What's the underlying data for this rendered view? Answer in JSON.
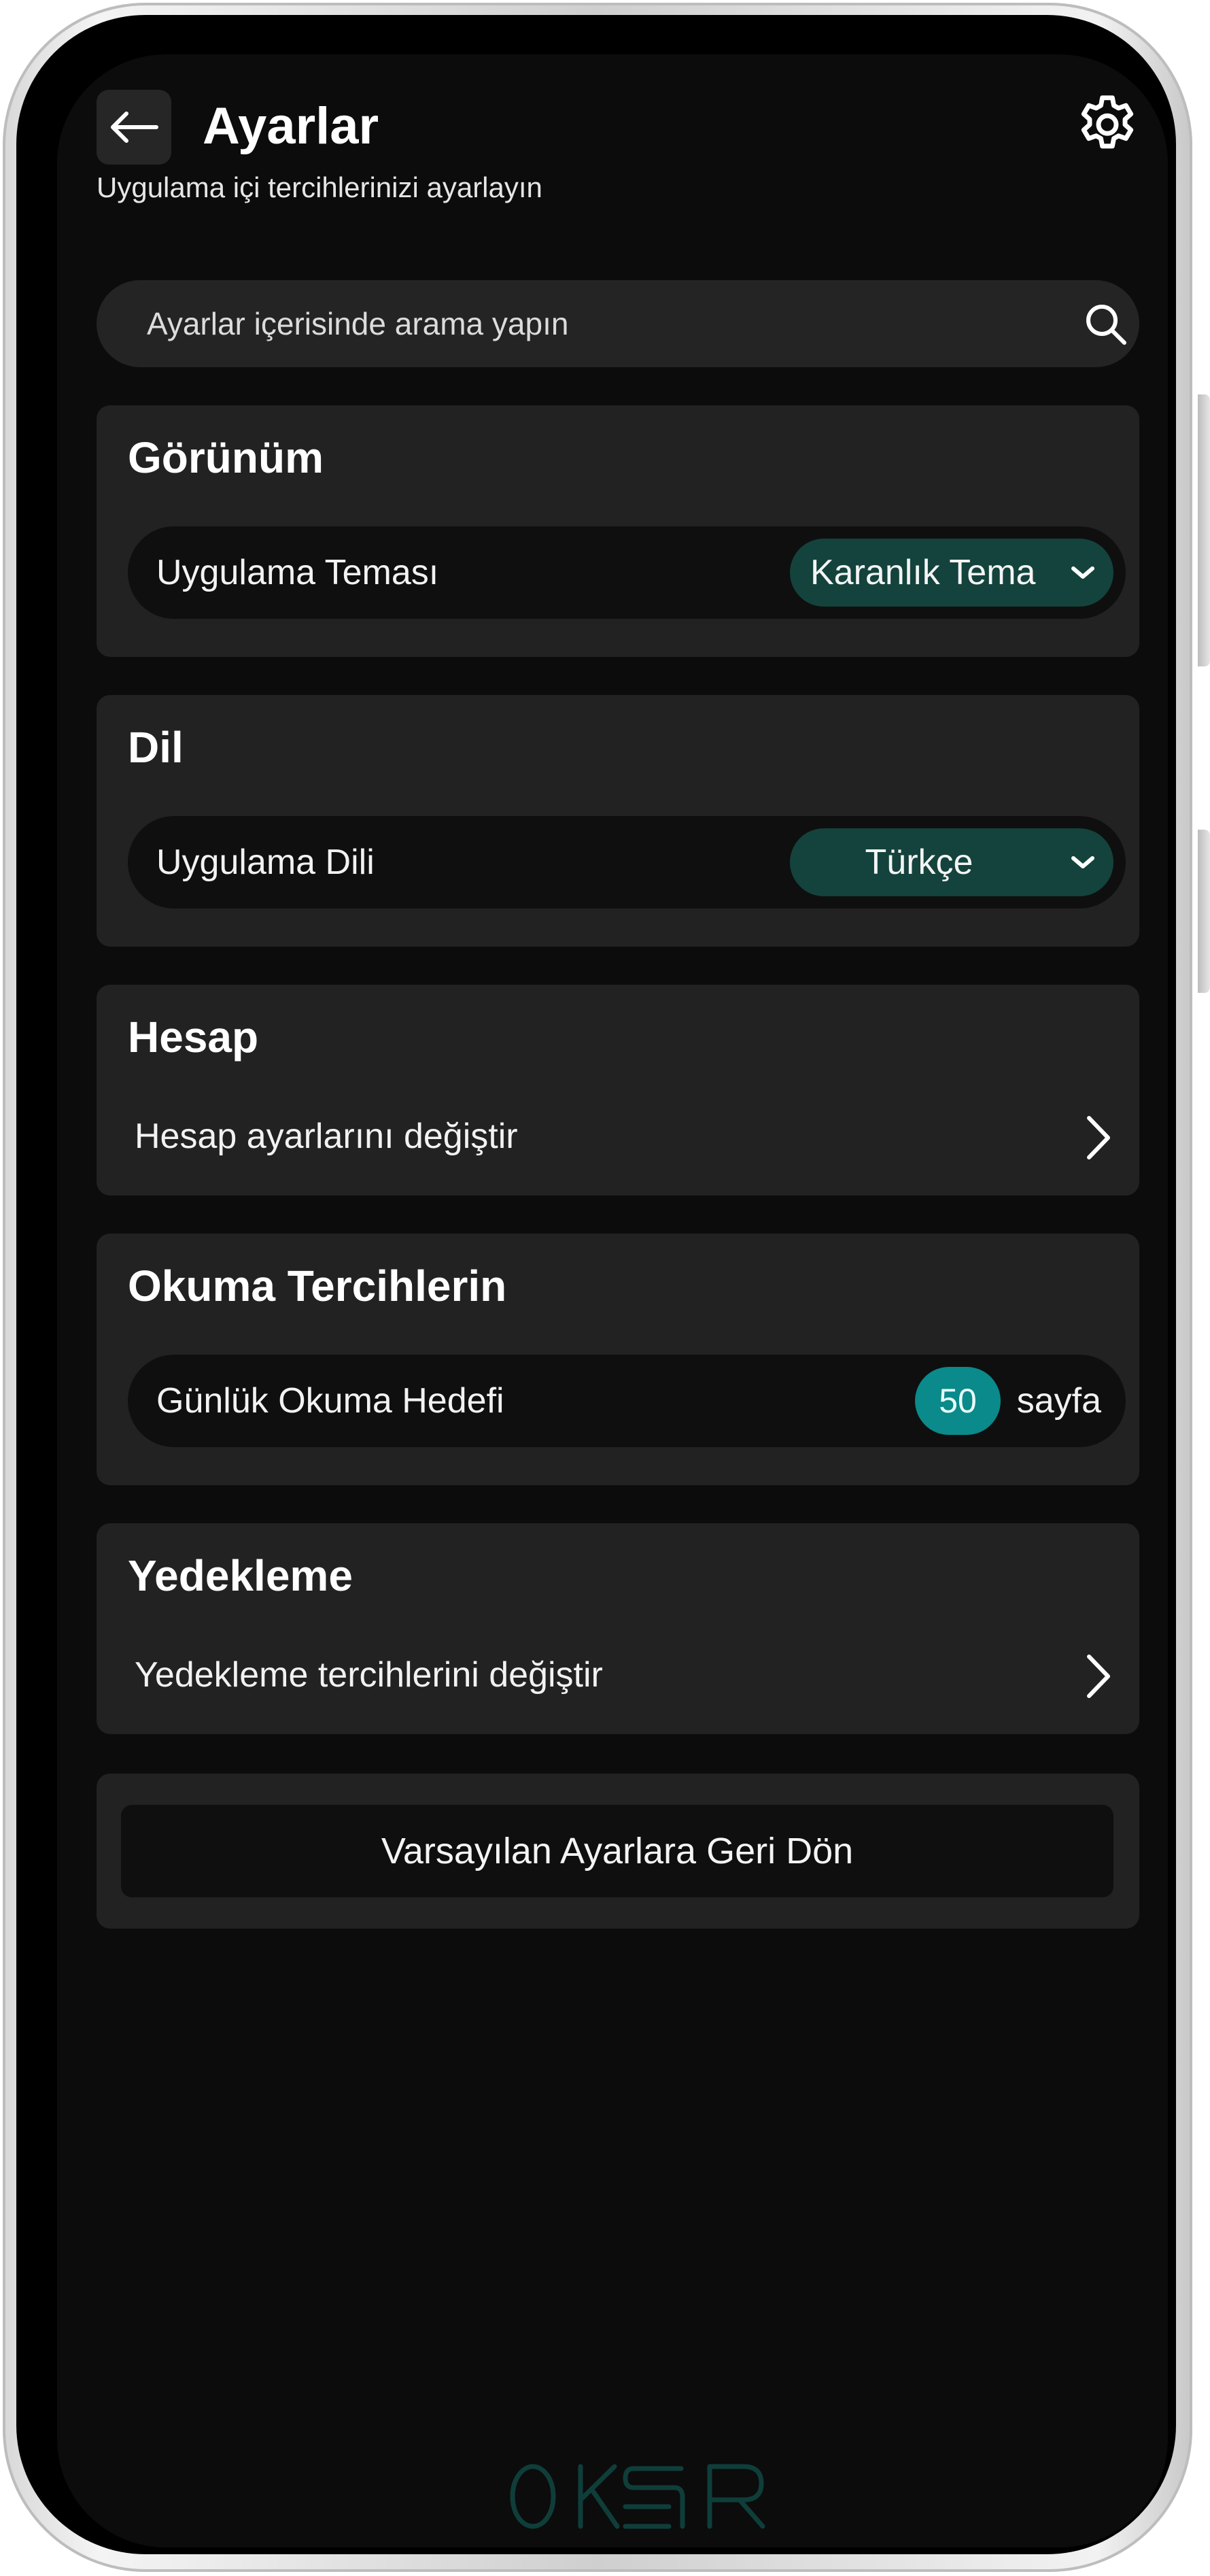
{
  "header": {
    "title": "Ayarlar",
    "subtitle": "Uygulama içi tercihlerinizi ayarlayın"
  },
  "search": {
    "placeholder": "Ayarlar içerisinde arama yapın"
  },
  "sections": {
    "appearance": {
      "title": "Görünüm",
      "row_label": "Uygulama Teması",
      "selected": "Karanlık Tema"
    },
    "language": {
      "title": "Dil",
      "row_label": "Uygulama Dili",
      "selected": "Türkçe"
    },
    "account": {
      "title": "Hesap",
      "link_label": "Hesap ayarlarını değiştir"
    },
    "reading": {
      "title": "Okuma Tercihlerin",
      "row_label": "Günlük Okuma Hedefi",
      "goal_value": "50",
      "goal_unit": "sayfa"
    },
    "backup": {
      "title": "Yedekleme",
      "link_label": "Yedekleme tercihlerini değiştir"
    }
  },
  "reset": {
    "label": "Varsayılan Ayarlara Geri Dön"
  },
  "brand": {
    "logo_text": "OKUR",
    "logo_color": "#0f3e3a"
  },
  "colors": {
    "accent_dropdown": "#13433c",
    "accent_badge": "#0a8a8a",
    "card_bg": "#222222",
    "screen_bg": "#0c0c0c"
  },
  "icons": {
    "back": "arrow-left-icon",
    "settings": "gear-icon",
    "search": "search-icon",
    "chevron": "chevron-right-icon",
    "dropdown": "chevron-down-icon"
  }
}
